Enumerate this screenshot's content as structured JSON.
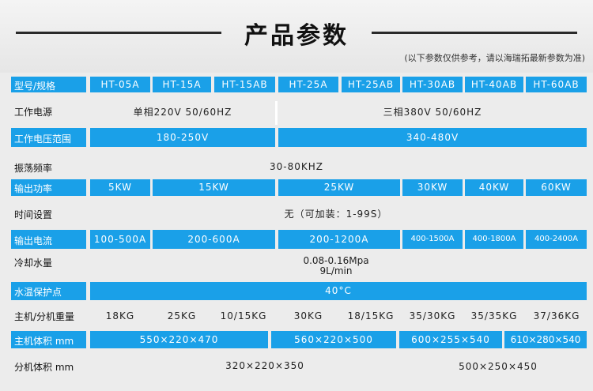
{
  "header": {
    "title": "产品参数",
    "note": "(以下参数仅供参考，请以海瑞拓最新参数为准)"
  },
  "model_row": {
    "label": "型号/规格",
    "models": [
      "HT-05A",
      "HT-15A",
      "HT-15AB",
      "HT-25A",
      "HT-25AB",
      "HT-30AB",
      "HT-40AB",
      "HT-60AB"
    ]
  },
  "power_supply": {
    "label": "工作电源",
    "single": "单相220V 50/60HZ",
    "three": "三相380V 50/60HZ"
  },
  "voltage_range": {
    "label": "工作电压范围",
    "single": "180-250V",
    "three": "340-480V"
  },
  "oscillation": {
    "label": "振荡频率",
    "value": "30-80KHZ"
  },
  "output_power": {
    "label": "输出功率",
    "values": [
      "5KW",
      "15KW",
      "25KW",
      "30KW",
      "40KW",
      "60KW"
    ]
  },
  "time_setting": {
    "label": "时间设置",
    "value": "无（可加装：1-99S）"
  },
  "output_current": {
    "label": "输出电流",
    "values": [
      "100-500A",
      "200-600A",
      "200-1200A",
      "400-1500A",
      "400-1800A",
      "400-2400A"
    ]
  },
  "cooling_water": {
    "label": "冷却水量",
    "line1": "0.08-0.16Mpa",
    "line2": "9L/min"
  },
  "water_temp": {
    "label": "水温保护点",
    "value": "40°C"
  },
  "weight": {
    "label": "主机/分机重量",
    "values": [
      "18KG",
      "25KG",
      "10/15KG",
      "30KG",
      "18/15KG",
      "35/30KG",
      "35/35KG",
      "37/36KG"
    ]
  },
  "host_size": {
    "label": "主机体积 mm",
    "values": [
      "550×220×470",
      "560×220×500",
      "600×255×540",
      "610×280×540"
    ]
  },
  "sub_size": {
    "label": "分机体积 mm",
    "values": [
      "320×220×350",
      "500×250×450"
    ]
  }
}
